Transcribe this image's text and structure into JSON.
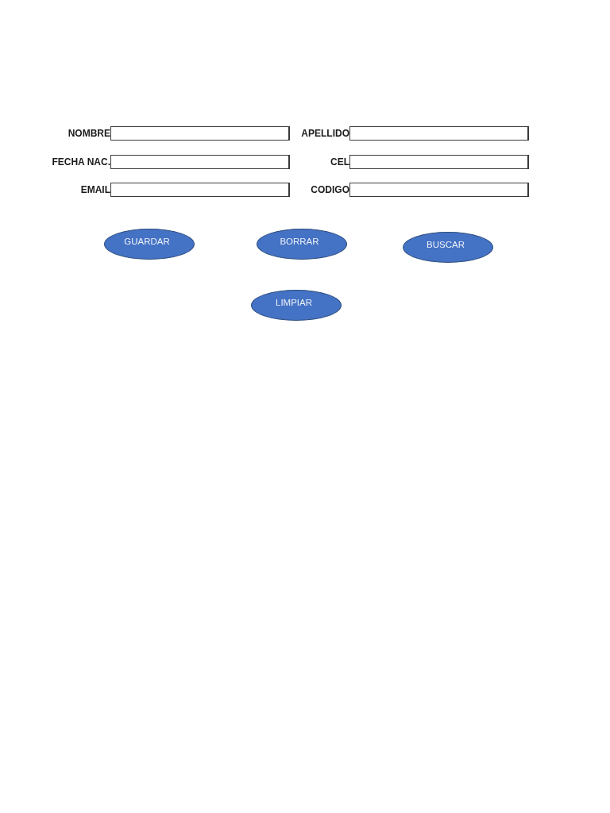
{
  "form": {
    "fields": [
      {
        "label": "NOMBRE"
      },
      {
        "label": "APELLIDO"
      },
      {
        "label": "FECHA NAC."
      },
      {
        "label": "CEL"
      },
      {
        "label": "EMAIL"
      },
      {
        "label": "CODIGO"
      }
    ]
  },
  "button_rows": [
    [
      "GUARDAR",
      "BORRAR",
      "BUSCAR"
    ],
    [
      "LIMPIAR"
    ]
  ]
}
